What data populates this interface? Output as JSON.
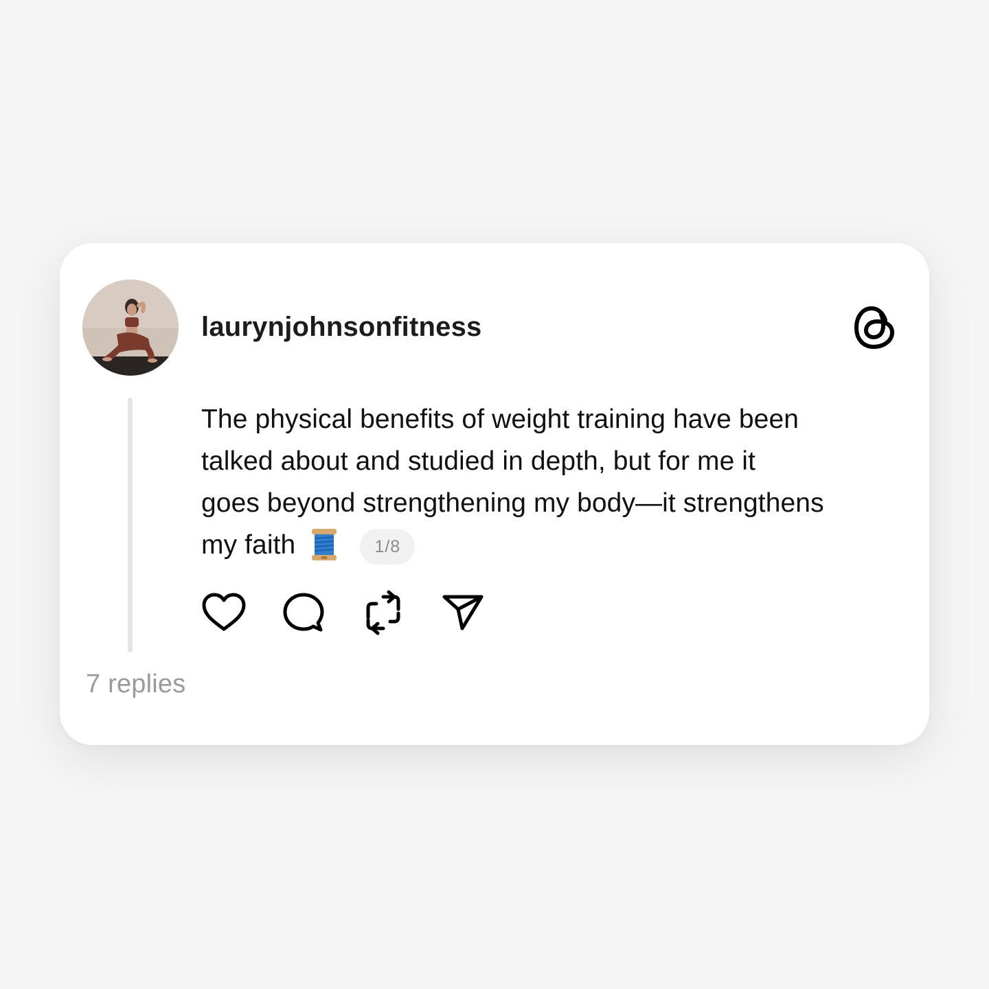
{
  "post": {
    "username": "laurynjohnsonfitness",
    "text_lines": [
      "The physical benefits of weight training have been",
      "talked about and studied in depth, but for me it",
      "goes beyond strengthening my body—it strengthens",
      "my faith"
    ],
    "thread_counter": "1/8",
    "replies": "7 replies"
  },
  "icons": {
    "logo": "threads-logo-icon",
    "avatar": "profile-photo",
    "emoji": "spool-of-thread-emoji",
    "actions": [
      "heart-icon",
      "comment-icon",
      "repost-icon",
      "share-icon"
    ]
  },
  "colors": {
    "page_background": "#f5f5f5",
    "card_background": "#ffffff",
    "text_primary": "#111111",
    "text_secondary": "#9a9a9a",
    "thread_line": "#e4e4e4"
  }
}
